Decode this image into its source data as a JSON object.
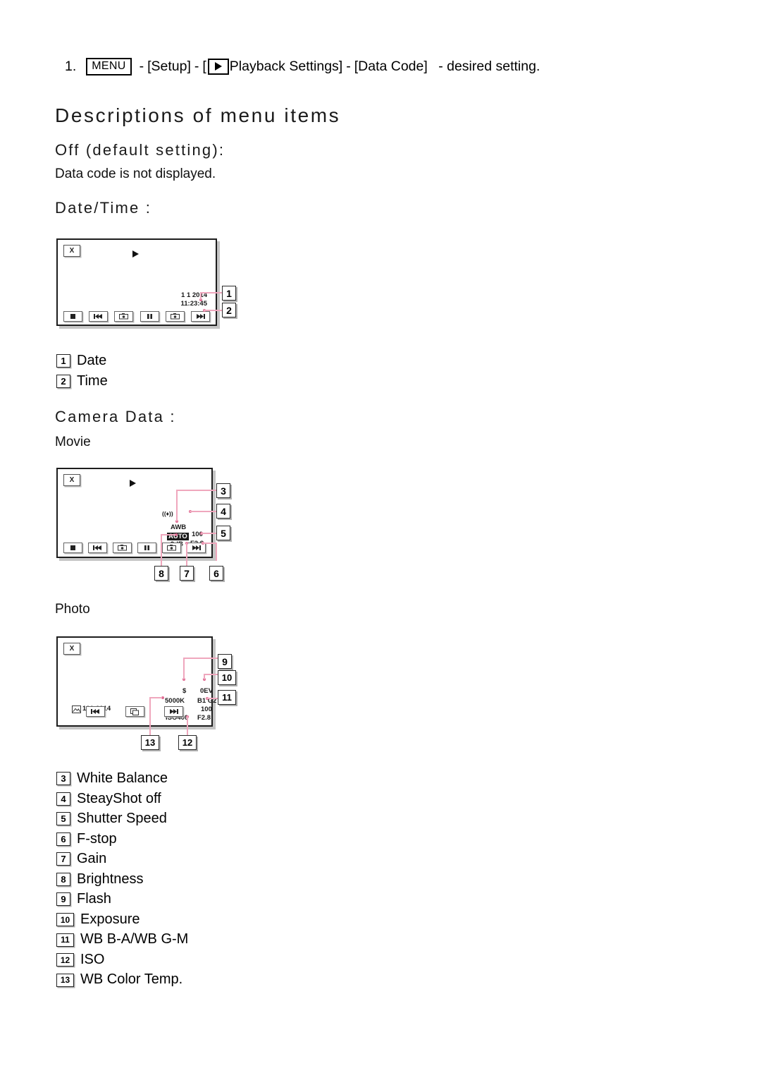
{
  "step": {
    "number": "1.",
    "menu_key": "MENU",
    "dash1": "-",
    "setup": "[Setup]",
    "dash2": "-",
    "bracket_open": "[",
    "playback_settings": "Playback Settings]",
    "dash3": "-",
    "data_code": "[Data Code]",
    "tail": "- desired setting."
  },
  "headings": {
    "main": "Descriptions of menu items",
    "off": "Off (default setting):",
    "off_desc": "Data code is not displayed.",
    "datetime": "Date/Time :",
    "cameradata": "Camera Data :",
    "movie": "Movie",
    "photo": "Photo"
  },
  "screens": {
    "datetime": {
      "close_label": "X",
      "date": "1 1 2014",
      "time": "11:23:45",
      "callouts": [
        {
          "num": "1",
          "target": "date"
        },
        {
          "num": "2",
          "target": "time"
        }
      ],
      "controls": [
        "stop-icon",
        "prev-icon",
        "photo-capture-icon",
        "pause-icon",
        "photo-capture-icon",
        "next-icon"
      ]
    },
    "movie": {
      "close_label": "X",
      "white_balance": "AWB",
      "steadyshot_off": "((♦))",
      "shutter_speed": "100",
      "fstop": "F2.8",
      "gain": "9dB",
      "brightness": "AUTO",
      "callouts": [
        {
          "num": "3",
          "target": "white-balance"
        },
        {
          "num": "4",
          "target": "steadyshot-off"
        },
        {
          "num": "5",
          "target": "shutter-speed"
        },
        {
          "num": "6",
          "target": "f-stop"
        },
        {
          "num": "7",
          "target": "gain"
        },
        {
          "num": "8",
          "target": "brightness"
        }
      ],
      "controls": [
        "stop-icon",
        "prev-icon",
        "photo-capture-icon",
        "pause-icon",
        "photo-capture-icon",
        "next-icon"
      ]
    },
    "photo": {
      "close_label": "X",
      "flash": "$",
      "exposure": "0EV",
      "wb_shift": "B1 G2",
      "shutter_speed": "100",
      "fstop": "F2.8",
      "wb_color_temp": "5000K",
      "iso": "ISO400",
      "file_number": "101-0014",
      "callouts": [
        {
          "num": "9",
          "target": "flash"
        },
        {
          "num": "10",
          "target": "exposure"
        },
        {
          "num": "11",
          "target": "wb-shift"
        },
        {
          "num": "12",
          "target": "iso"
        },
        {
          "num": "13",
          "target": "wb-color-temp"
        }
      ],
      "controls": [
        "prev-icon",
        "slideshow-icon",
        "next-icon"
      ]
    }
  },
  "legend_top": [
    {
      "num": "1",
      "label": "Date"
    },
    {
      "num": "2",
      "label": "Time"
    }
  ],
  "legend_bottom": [
    {
      "num": "3",
      "label": "White Balance"
    },
    {
      "num": "4",
      "label": "SteayShot off"
    },
    {
      "num": "5",
      "label": "Shutter Speed"
    },
    {
      "num": "6",
      "label": "F-stop"
    },
    {
      "num": "7",
      "label": "Gain"
    },
    {
      "num": "8",
      "label": "Brightness"
    },
    {
      "num": "9",
      "label": "Flash"
    },
    {
      "num": "10",
      "label": "Exposure"
    },
    {
      "num": "11",
      "label": "WB B-A/WB G-M"
    },
    {
      "num": "12",
      "label": "ISO"
    },
    {
      "num": "13",
      "label": "WB Color Temp."
    }
  ],
  "colors": {
    "leader": "#efa7bd",
    "dot": "#e06c93",
    "text": "#000000"
  }
}
